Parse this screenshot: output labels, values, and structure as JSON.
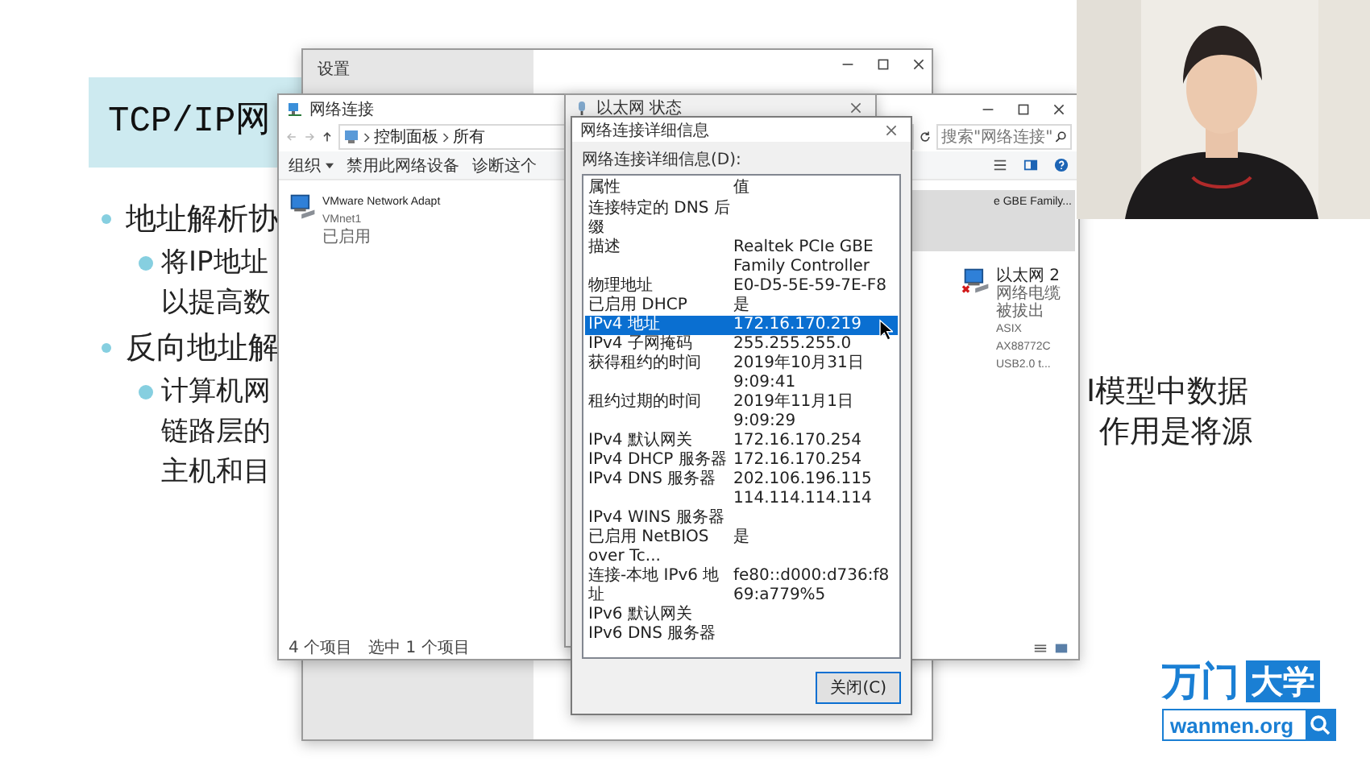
{
  "slide": {
    "title": "TCP/IP网",
    "bullets": [
      {
        "text": "地址解析协",
        "children": [
          {
            "lines": [
              "将IP地址",
              "以提高数"
            ]
          }
        ]
      },
      {
        "text": "反向地址解",
        "children": [
          {
            "lines": [
              "计算机网",
              "链路层的",
              "主机和目"
            ]
          }
        ]
      }
    ],
    "fragments": [
      "I模型中数据",
      "作用是将源"
    ]
  },
  "settings_window": {
    "title": "设置"
  },
  "network_window": {
    "title": "网络连接",
    "breadcrumb": [
      "控制面板",
      "所有"
    ],
    "search": {
      "placeholder": "搜索\"网络连接\""
    },
    "toolbar": [
      "组织",
      "禁用此网络设备",
      "诊断这个"
    ],
    "items": [
      {
        "lines": [
          "VMware Network Adapt",
          "VMnet1",
          "已启用"
        ],
        "kind": "enabled",
        "selected": false
      },
      {
        "lines": [
          "e GBE Family..."
        ],
        "kind": "clipped",
        "selected": true
      },
      {
        "lines": [
          "以太网 2",
          "网络电缆被拔出",
          "ASIX AX88772C USB2.0 t..."
        ],
        "kind": "unplugged",
        "selected": false
      }
    ],
    "status_bar": [
      "4 个项目",
      "选中 1 个项目"
    ]
  },
  "status_window": {
    "title": "以太网 状态"
  },
  "details_dialog": {
    "title": "网络连接详细信息",
    "list_label": "网络连接详细信息(D):",
    "columns": [
      "属性",
      "值"
    ],
    "rows": [
      {
        "property": "连接特定的 DNS 后缀",
        "selected": false
      },
      {
        "property": "描述",
        "value": "Realtek PCIe GBE Family Controller",
        "selected": false
      },
      {
        "property": "物理地址",
        "value": "E0-D5-5E-59-7E-F8",
        "selected": false
      },
      {
        "property": "已启用 DHCP",
        "value": "是",
        "selected": false
      },
      {
        "property": "IPv4 地址",
        "value": "172.16.170.219",
        "selected": true
      },
      {
        "property": "IPv4 子网掩码",
        "value": "255.255.255.0",
        "selected": false
      },
      {
        "property": "获得租约的时间",
        "value": "2019年10月31日 9:09:41",
        "selected": false
      },
      {
        "property": "租约过期的时间",
        "value": "2019年11月1日 9:09:29",
        "selected": false
      },
      {
        "property": "IPv4 默认网关",
        "value": "172.16.170.254",
        "selected": false
      },
      {
        "property": "IPv4 DHCP 服务器",
        "value": "172.16.170.254",
        "selected": false
      },
      {
        "property": "IPv4 DNS 服务器",
        "value": "202.106.196.115",
        "selected": false
      },
      {
        "value": "114.114.114.114",
        "selected": false
      },
      {
        "property": "IPv4 WINS 服务器",
        "selected": false
      },
      {
        "property": "已启用 NetBIOS over Tc...",
        "value": "是",
        "selected": false
      },
      {
        "property": "连接-本地 IPv6 地址",
        "value": "fe80::d000:d736:f869:a779%5",
        "selected": false
      },
      {
        "property": "IPv6 默认网关",
        "selected": false
      },
      {
        "property": "IPv6 DNS 服务器",
        "selected": false
      }
    ],
    "button": "关闭(C)"
  },
  "logo": {
    "brand": "万门",
    "badge": "大学",
    "url": "wanmen.org"
  }
}
